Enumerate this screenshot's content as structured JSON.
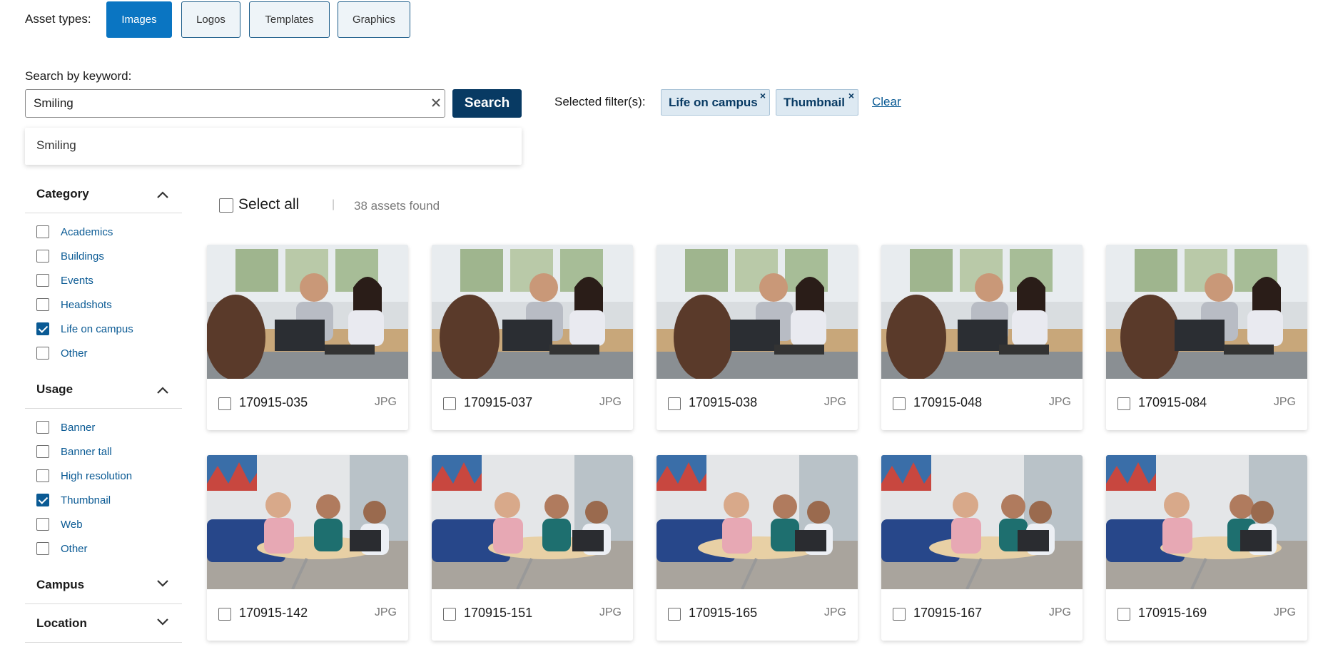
{
  "asset_types": {
    "label": "Asset types:",
    "buttons": [
      "Images",
      "Logos",
      "Templates",
      "Graphics"
    ],
    "active": "Images"
  },
  "search": {
    "label": "Search by keyword:",
    "value": "Smiling",
    "button": "Search",
    "suggestion": "Smiling"
  },
  "selected_filters": {
    "label": "Selected filter(s):",
    "chips": [
      "Life on campus",
      "Thumbnail"
    ],
    "chip_remove": "×",
    "clear": "Clear"
  },
  "sidebar": {
    "category": {
      "title": "Category",
      "items": [
        {
          "label": "Academics",
          "checked": false
        },
        {
          "label": "Buildings",
          "checked": false
        },
        {
          "label": "Events",
          "checked": false
        },
        {
          "label": "Headshots",
          "checked": false
        },
        {
          "label": "Life on campus",
          "checked": true
        },
        {
          "label": "Other",
          "checked": false
        }
      ]
    },
    "usage": {
      "title": "Usage",
      "items": [
        {
          "label": "Banner",
          "checked": false
        },
        {
          "label": "Banner tall",
          "checked": false
        },
        {
          "label": "High resolution",
          "checked": false
        },
        {
          "label": "Thumbnail",
          "checked": true
        },
        {
          "label": "Web",
          "checked": false
        },
        {
          "label": "Other",
          "checked": false
        }
      ]
    },
    "campus": {
      "title": "Campus"
    },
    "location": {
      "title": "Location"
    }
  },
  "results": {
    "select_all": "Select all",
    "divider": "|",
    "count": "38 assets found",
    "assets": [
      {
        "name": "170915-035",
        "type": "JPG",
        "scene": "office"
      },
      {
        "name": "170915-037",
        "type": "JPG",
        "scene": "office"
      },
      {
        "name": "170915-038",
        "type": "JPG",
        "scene": "office"
      },
      {
        "name": "170915-048",
        "type": "JPG",
        "scene": "office"
      },
      {
        "name": "170915-084",
        "type": "JPG",
        "scene": "office"
      },
      {
        "name": "170915-142",
        "type": "JPG",
        "scene": "lounge"
      },
      {
        "name": "170915-151",
        "type": "JPG",
        "scene": "lounge"
      },
      {
        "name": "170915-165",
        "type": "JPG",
        "scene": "lounge"
      },
      {
        "name": "170915-167",
        "type": "JPG",
        "scene": "lounge"
      },
      {
        "name": "170915-169",
        "type": "JPG",
        "scene": "lounge"
      }
    ]
  },
  "colors": {
    "primary": "#0a75c2",
    "dark_navy": "#083a63",
    "link": "#0a5a94",
    "chip_bg": "#dde9f2"
  }
}
